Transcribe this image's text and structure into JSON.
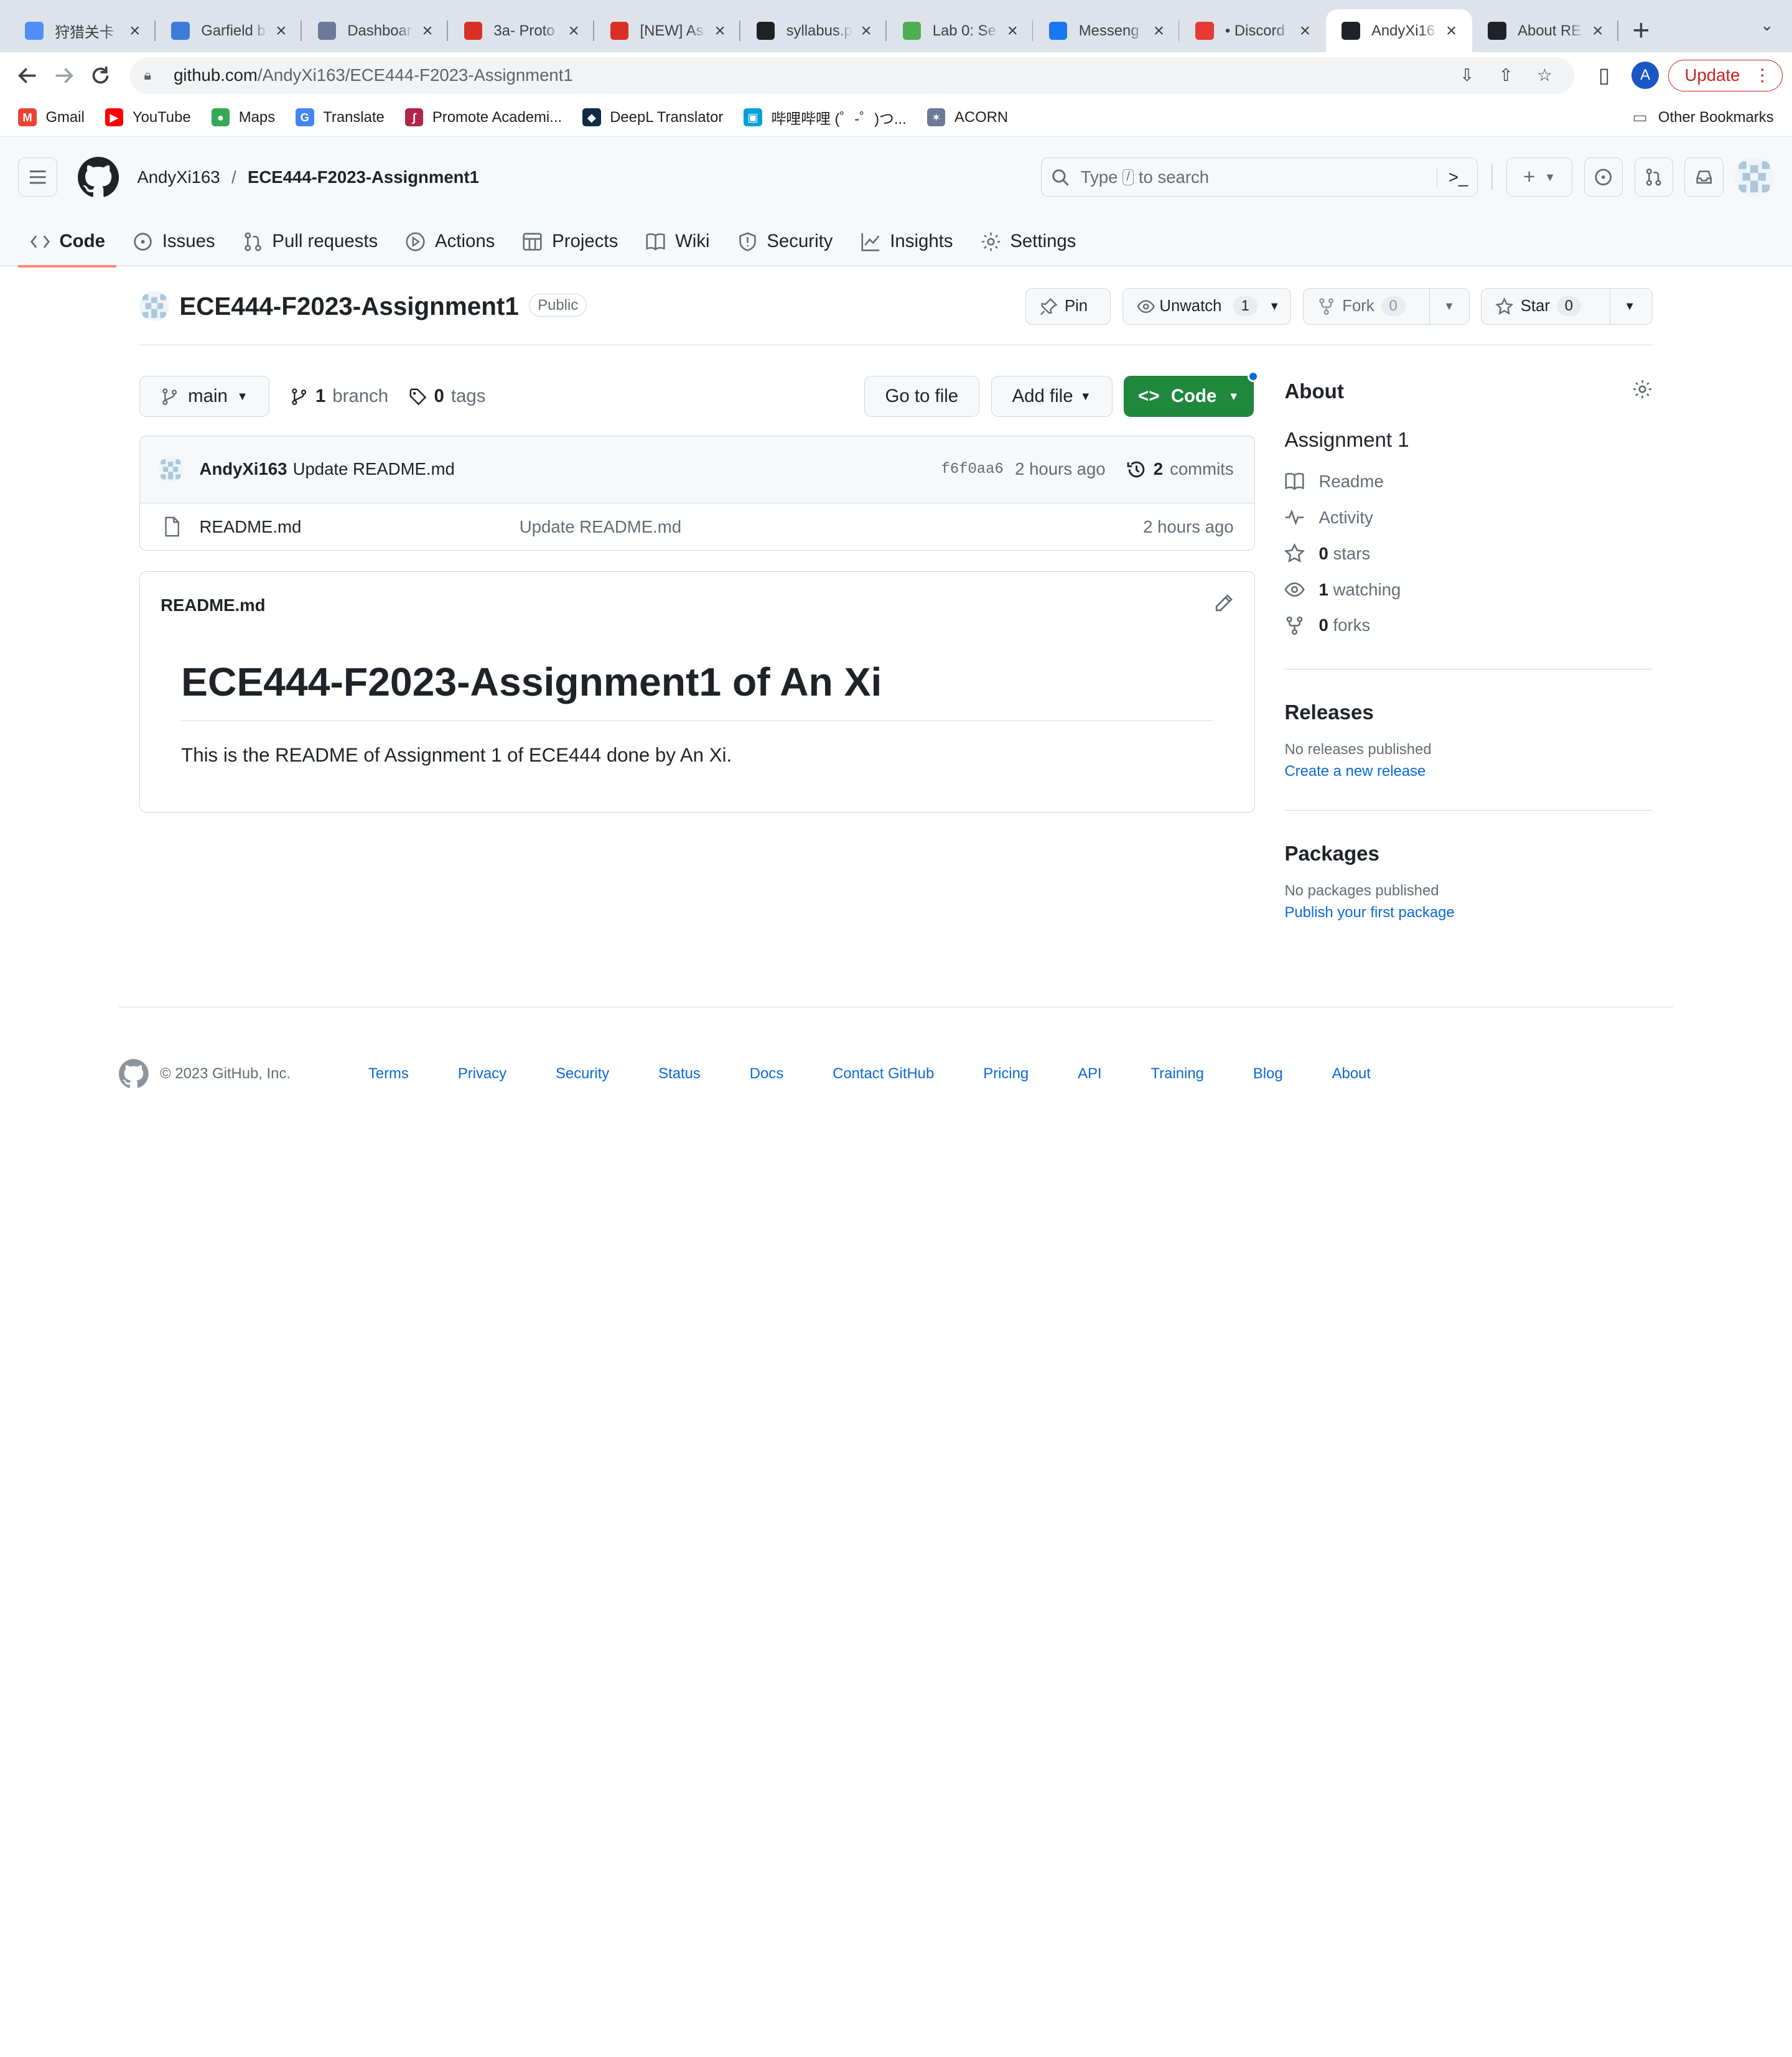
{
  "browser": {
    "tabs": [
      {
        "title": "狩猎关卡",
        "icon": "triangle-app-icon",
        "color": "#4f8ef7"
      },
      {
        "title": "Garfield b",
        "icon": "shield-icon",
        "color": "#3e7bd9"
      },
      {
        "title": "Dashboar",
        "icon": "university-crest-icon",
        "color": "#6b7a99"
      },
      {
        "title": "3a- Proto",
        "icon": "gear-red-icon",
        "color": "#d93025"
      },
      {
        "title": "[NEW] As",
        "icon": "gear-red-icon",
        "color": "#d93025"
      },
      {
        "title": "syllabus.p",
        "icon": "globe-icon",
        "color": "#202124"
      },
      {
        "title": "Lab 0: Se",
        "icon": "doc-green-icon",
        "color": "#4caf50"
      },
      {
        "title": "Messeng",
        "icon": "facebook-icon",
        "color": "#1877f2"
      },
      {
        "title": "• Discord",
        "icon": "discord-icon",
        "color": "#e53935"
      },
      {
        "title": "AndyXi16",
        "icon": "github-icon",
        "color": "#1f2328"
      },
      {
        "title": "About RE",
        "icon": "github-icon",
        "color": "#1f2328"
      }
    ],
    "active_tab": 9,
    "url_host": "github.com",
    "url_path": "/AndyXi163/ECE444-F2023-Assignment1",
    "profile_initial": "A",
    "update_label": "Update",
    "bookmarks": [
      {
        "label": "Gmail",
        "icon": "gmail-icon",
        "color": "#ea4335",
        "glyph": "M"
      },
      {
        "label": "YouTube",
        "icon": "youtube-icon",
        "color": "#ff0000",
        "glyph": "▶"
      },
      {
        "label": "Maps",
        "icon": "maps-pin-icon",
        "color": "#34a853",
        "glyph": "●"
      },
      {
        "label": "Translate",
        "icon": "translate-icon",
        "color": "#4285f4",
        "glyph": "G"
      },
      {
        "label": "Promote Academi...",
        "icon": "stethoscope-icon",
        "color": "#b0274a",
        "glyph": "∫"
      },
      {
        "label": "DeepL Translator",
        "icon": "deepl-icon",
        "color": "#0f2b46",
        "glyph": "◆"
      },
      {
        "label": "哔哩哔哩 (゜-゜)つ...",
        "icon": "bilibili-icon",
        "color": "#00a1d6",
        "glyph": "▣"
      },
      {
        "label": "ACORN",
        "icon": "acorn-crest-icon",
        "color": "#6b7a99",
        "glyph": "✶"
      }
    ],
    "other_bookmarks": "Other Bookmarks"
  },
  "header": {
    "owner": "AndyXi163",
    "separator": "/",
    "repo": "ECE444-F2023-Assignment1",
    "search_prefix": "Type",
    "search_key": "/",
    "search_suffix": "to search"
  },
  "nav": [
    {
      "label": "Code",
      "icon": "code-icon"
    },
    {
      "label": "Issues",
      "icon": "issue-icon"
    },
    {
      "label": "Pull requests",
      "icon": "pull-request-icon"
    },
    {
      "label": "Actions",
      "icon": "play-icon"
    },
    {
      "label": "Projects",
      "icon": "table-icon"
    },
    {
      "label": "Wiki",
      "icon": "book-icon"
    },
    {
      "label": "Security",
      "icon": "shield-icon"
    },
    {
      "label": "Insights",
      "icon": "graph-icon"
    },
    {
      "label": "Settings",
      "icon": "gear-icon"
    }
  ],
  "repo": {
    "name": "ECE444-F2023-Assignment1",
    "visibility": "Public",
    "pin": "Pin",
    "unwatch": "Unwatch",
    "watch_count": "1",
    "fork": "Fork",
    "fork_count": "0",
    "star": "Star",
    "star_count": "0"
  },
  "filenav": {
    "branch": "main",
    "branch_count": "1",
    "branch_label": "branch",
    "tag_count": "0",
    "tag_label": "tags",
    "go_to_file": "Go to file",
    "add_file": "Add file",
    "code": "Code"
  },
  "commit": {
    "author": "AndyXi163",
    "message": "Update README.md",
    "sha": "f6f0aa6",
    "age": "2 hours ago",
    "commit_count": "2",
    "commit_label": "commits"
  },
  "files": [
    {
      "name": "README.md",
      "message": "Update README.md",
      "age": "2 hours ago"
    }
  ],
  "readme": {
    "filename": "README.md",
    "heading": "ECE444-F2023-Assignment1 of An Xi",
    "body": "This is the README of Assignment 1 of ECE444 done by An Xi."
  },
  "about": {
    "title": "About",
    "description": "Assignment 1",
    "items": [
      {
        "icon": "book-icon",
        "count": "",
        "label": "Readme"
      },
      {
        "icon": "pulse-icon",
        "count": "",
        "label": "Activity"
      },
      {
        "icon": "star-icon",
        "count": "0",
        "label": "stars"
      },
      {
        "icon": "eye-icon",
        "count": "1",
        "label": "watching"
      },
      {
        "icon": "fork-icon",
        "count": "0",
        "label": "forks"
      }
    ]
  },
  "releases": {
    "title": "Releases",
    "note": "No releases published",
    "link": "Create a new release"
  },
  "packages": {
    "title": "Packages",
    "note": "No packages published",
    "link": "Publish your first package"
  },
  "footer": {
    "copyright": "© 2023 GitHub, Inc.",
    "links": [
      "Terms",
      "Privacy",
      "Security",
      "Status",
      "Docs",
      "Contact GitHub",
      "Pricing",
      "API",
      "Training",
      "Blog",
      "About"
    ]
  }
}
